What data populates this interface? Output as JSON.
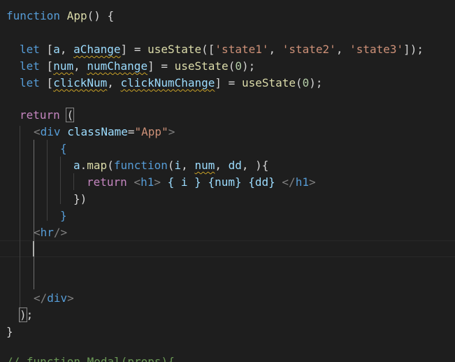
{
  "editor": {
    "colors": {
      "background": "#1e1e1e",
      "keyword": "#569cd6",
      "control_keyword": "#c586c0",
      "function": "#dcdcaa",
      "variable": "#9cdcfe",
      "string": "#ce9178",
      "number": "#b5cea8",
      "tag_bracket": "#808080",
      "comment": "#6a9955"
    },
    "lines": {
      "l1": {
        "kw": "function",
        "name": "App",
        "rest": "() {"
      },
      "l3": {
        "kw": "let",
        "open": "[",
        "v1": "a",
        "comma": ",",
        "v2": "aChange",
        "close": "]",
        "eq": " = ",
        "fn": "useState",
        "args_open": "([",
        "s1": "'state1'",
        "sep1": ", ",
        "s2": "'state2'",
        "sep2": ", ",
        "s3": "'state3'",
        "args_close": "]);"
      },
      "l4": {
        "kw": "let",
        "open": "[",
        "v1": "num",
        "comma": ",",
        "v2": "numChange",
        "close": "]",
        "eq": " = ",
        "fn": "useState",
        "po": "(",
        "n": "0",
        "pc": ");"
      },
      "l5": {
        "kw": "let",
        "open": "[",
        "v1": "clickNum",
        "comma": ",",
        "v2": "clickNumChange",
        "close": "]",
        "eq": " = ",
        "fn": "useState",
        "po": "(",
        "n": "0",
        "pc": ");"
      },
      "l7": {
        "kw": "return",
        "paren": "("
      },
      "l8": {
        "lt": "<",
        "tag": "div",
        "attr": "className",
        "eq": "=",
        "val": "\"App\"",
        "gt": ">"
      },
      "l9": {
        "brace": "{"
      },
      "l10": {
        "obj": "a",
        "dot": ".",
        "fn": "map",
        "po": "(",
        "kw": "function",
        "p_open": "(",
        "p1": "i",
        "c1": ", ",
        "p2": "num",
        "c2": ", ",
        "p3": "dd",
        "p_close": ", ){"
      },
      "l11": {
        "kw": "return",
        "lt": "<",
        "tag": "h1",
        "gt": ">",
        "e1": "{ i }",
        "e2": "{num}",
        "e3": "{dd}",
        "clt": "</",
        "ctag": "h1",
        "cgt": ">"
      },
      "l12": {
        "text": "})"
      },
      "l13": {
        "brace": "}"
      },
      "l14": {
        "lt": "<",
        "tag": "hr",
        "gt": "/>"
      },
      "l18": {
        "lt": "</",
        "tag": "div",
        "gt": ">"
      },
      "l19": {
        "paren": ")",
        "semi": ";"
      },
      "l20": {
        "text": "}"
      },
      "l22": {
        "text": "// function Modal(props){"
      }
    }
  }
}
